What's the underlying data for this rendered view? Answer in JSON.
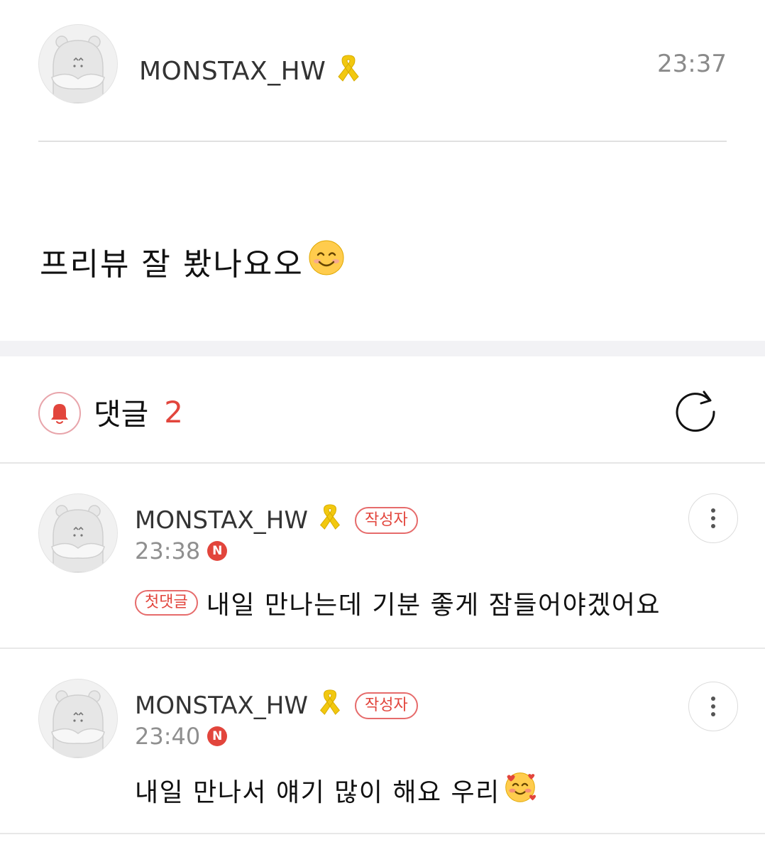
{
  "post": {
    "author": "MONSTAX_HW",
    "time": "23:37",
    "body": "프리뷰 잘 봤나요오",
    "body_emoji": "smiling-face-emoji",
    "ribbon_icon": "yellow-ribbon-icon"
  },
  "comments_header": {
    "title": "댓글",
    "count": "2",
    "accent_color": "#e2453c"
  },
  "comments": [
    {
      "author": "MONSTAX_HW",
      "author_badge": "작성자",
      "time": "23:38",
      "new_badge": "N",
      "first_badge": "첫댓글",
      "text": "내일 만나는데 기분 좋게 잠들어야겠어요"
    },
    {
      "author": "MONSTAX_HW",
      "author_badge": "작성자",
      "time": "23:40",
      "new_badge": "N",
      "text": "내일 만나서 얘기 많이 해요 우리",
      "emoji": "smiling-face-with-hearts-emoji"
    }
  ]
}
